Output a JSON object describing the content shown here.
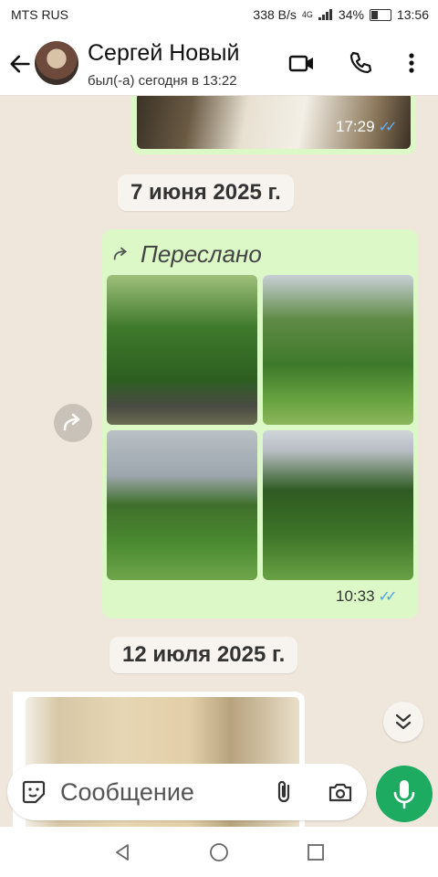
{
  "status_bar": {
    "carrier": "MTS RUS",
    "net_speed": "338 B/s",
    "network": "4G",
    "battery": "34%",
    "time": "13:56"
  },
  "header": {
    "contact_name": "Сергей Новый",
    "last_seen": "был(-а) сегодня в 13:22"
  },
  "messages": {
    "top_time": "17:29",
    "date_1": "7 июня 2025 г.",
    "forwarded_label": "Переслано",
    "album_time": "10:33",
    "date_2": "12 июля 2025 г."
  },
  "input": {
    "placeholder": "Сообщение"
  },
  "colors": {
    "bubble_out": "#dcf8c6",
    "accent_green": "#1daa61",
    "read_ticks": "#4fa3e8"
  }
}
